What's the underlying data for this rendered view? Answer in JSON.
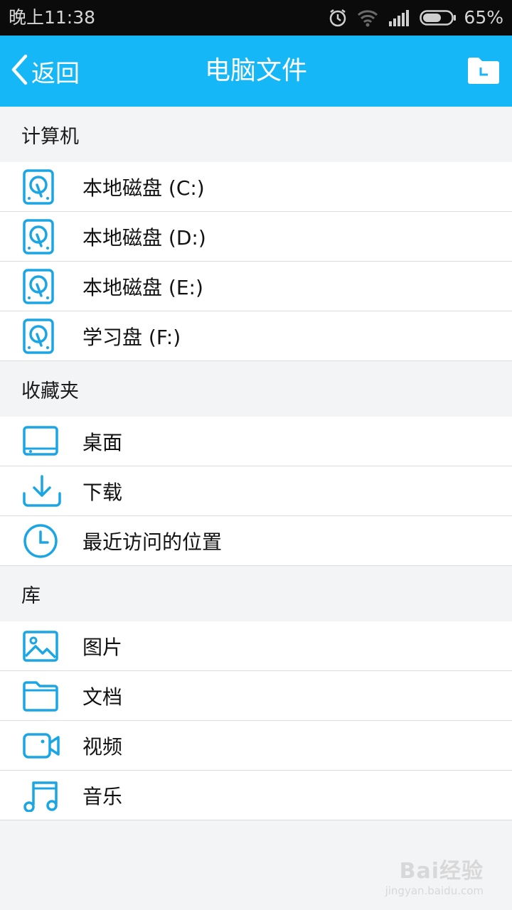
{
  "status_bar": {
    "time": "晚上11:38",
    "battery_percent": "65%",
    "battery_level": 0.65,
    "icons": [
      "alarm-icon",
      "wifi-icon",
      "signal-icon",
      "battery-icon"
    ]
  },
  "header": {
    "back_label": "返回",
    "title": "电脑文件",
    "action_icon": "folder-clock-icon"
  },
  "colors": {
    "header_bg": "#16b7f6",
    "icon_blue": "#1aa6e4",
    "status_bg": "#0b0b0b"
  },
  "sections": [
    {
      "title": "计算机",
      "items": [
        {
          "label": "本地磁盘 (C:)",
          "icon": "disk-icon"
        },
        {
          "label": "本地磁盘 (D:)",
          "icon": "disk-icon"
        },
        {
          "label": "本地磁盘 (E:)",
          "icon": "disk-icon"
        },
        {
          "label": "学习盘 (F:)",
          "icon": "disk-icon"
        }
      ]
    },
    {
      "title": "收藏夹",
      "items": [
        {
          "label": "桌面",
          "icon": "desktop-icon"
        },
        {
          "label": "下载",
          "icon": "download-icon"
        },
        {
          "label": "最近访问的位置",
          "icon": "clock-icon"
        }
      ]
    },
    {
      "title": "库",
      "items": [
        {
          "label": "图片",
          "icon": "image-icon"
        },
        {
          "label": "文档",
          "icon": "folder-icon"
        },
        {
          "label": "视频",
          "icon": "video-icon"
        },
        {
          "label": "音乐",
          "icon": "music-icon"
        }
      ]
    }
  ],
  "watermark": {
    "main": "Bai经验",
    "sub": "jingyan.baidu.com"
  }
}
